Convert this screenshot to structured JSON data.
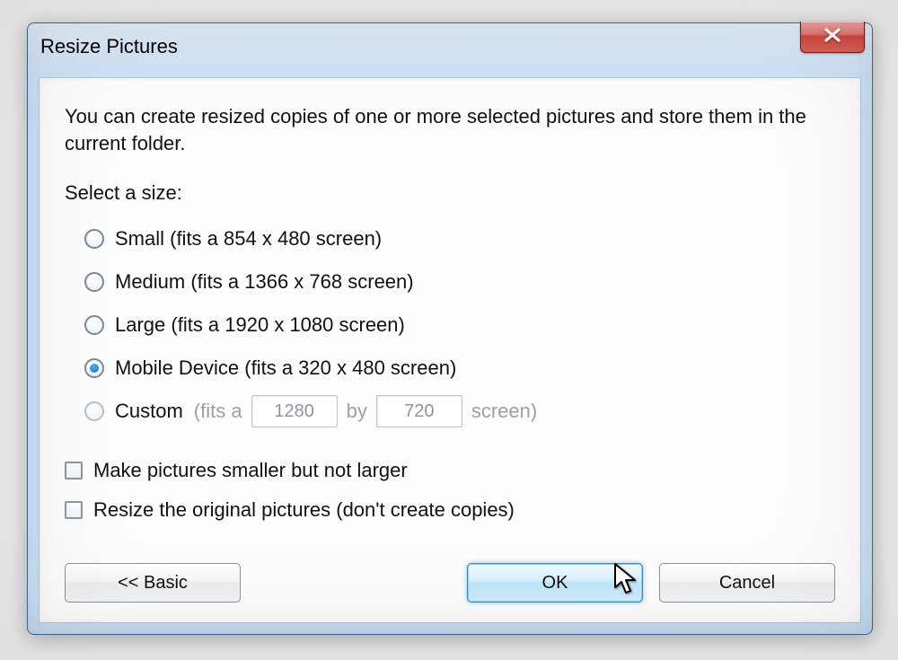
{
  "window": {
    "title": "Resize Pictures"
  },
  "body": {
    "intro": "You can create resized copies of one or more selected pictures and store them in the current folder.",
    "prompt": "Select a size:"
  },
  "sizes": {
    "small": "Small (fits a 854 x 480 screen)",
    "medium": "Medium (fits a 1366 x 768 screen)",
    "large": "Large (fits a 1920 x 1080 screen)",
    "mobile": "Mobile Device (fits a 320 x 480 screen)",
    "custom_label": "Custom",
    "custom_prefix": "(fits a",
    "custom_mid": "by",
    "custom_suffix": "screen)",
    "custom_w": "1280",
    "custom_h": "720",
    "selected": "mobile"
  },
  "checks": {
    "smaller_only": "Make pictures smaller but not larger",
    "replace_originals": "Resize the original pictures (don't create copies)"
  },
  "buttons": {
    "basic": "<< Basic",
    "ok": "OK",
    "cancel": "Cancel"
  }
}
